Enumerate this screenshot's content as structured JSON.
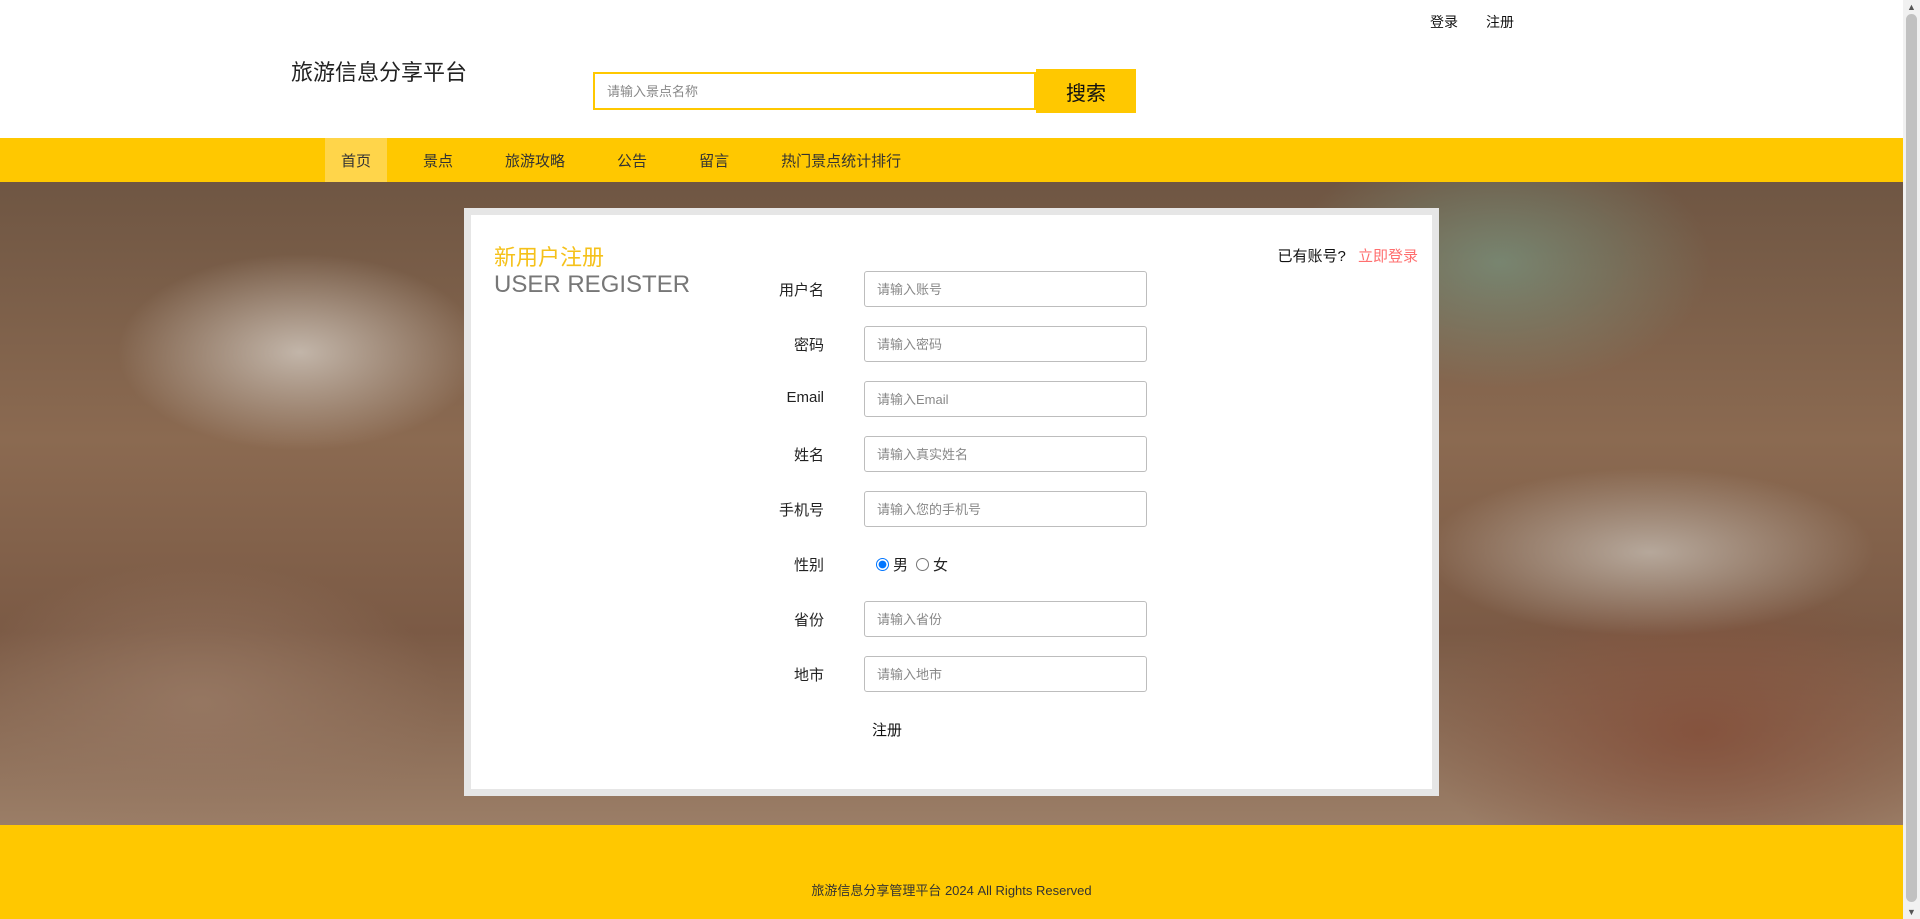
{
  "top_links": {
    "login": "登录",
    "register": "注册"
  },
  "header": {
    "site_title": "旅游信息分享平台",
    "search_placeholder": "请输入景点名称",
    "search_button": "搜索"
  },
  "nav": {
    "items": [
      {
        "label": "首页",
        "active": true
      },
      {
        "label": "景点"
      },
      {
        "label": "旅游攻略"
      },
      {
        "label": "公告"
      },
      {
        "label": "留言"
      },
      {
        "label": "热门景点统计排行"
      }
    ]
  },
  "register": {
    "title_cn": "新用户注册",
    "title_en": "USER REGISTER",
    "login_hint": "已有账号?",
    "login_link": "立即登录",
    "fields": [
      {
        "label": "用户名",
        "placeholder": "请输入账号"
      },
      {
        "label": "密码",
        "placeholder": "请输入密码"
      },
      {
        "label": "Email",
        "placeholder": "请输入Email"
      },
      {
        "label": "姓名",
        "placeholder": "请输入真实姓名"
      },
      {
        "label": "手机号",
        "placeholder": "请输入您的手机号"
      },
      {
        "label": "省份",
        "placeholder": "请输入省份"
      },
      {
        "label": "地市",
        "placeholder": "请输入地市"
      }
    ],
    "gender": {
      "label": "性别",
      "male": "男",
      "female": "女",
      "selected": "男"
    },
    "submit": "注册"
  },
  "footer": {
    "text": "旅游信息分享管理平台 2024 All Rights Reserved"
  },
  "colors": {
    "yellow": "#ffc800",
    "accent": "#f5c11a",
    "link": "#ff6f6f"
  }
}
